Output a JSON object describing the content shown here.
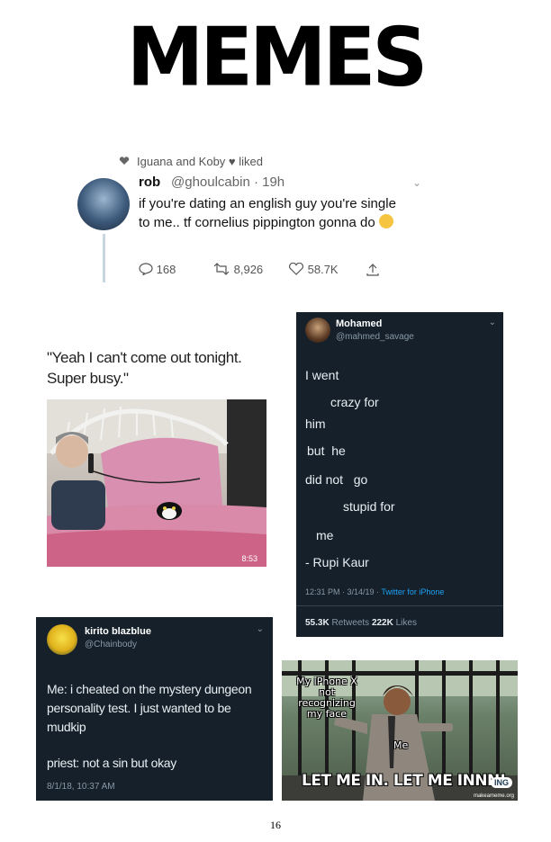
{
  "title": "MEMES",
  "tweet1": {
    "liked_by": "Iguana and Koby ♥ liked",
    "name": "rob",
    "handle_time": "@ghoulcabin · 19h",
    "text": "if you're dating an english guy you're single to me.. tf cornelius pippington gonna do",
    "replies": "168",
    "retweets": "8,926",
    "likes": "58.7K"
  },
  "quote_post": {
    "quote": "\"Yeah I can't come out tonight. Super busy.\"",
    "watermark": "8:53"
  },
  "tweet_rupi": {
    "name": "Mohamed",
    "handle": "@mahmed_savage",
    "lines": [
      "I went",
      "crazy for",
      "him",
      "but  he",
      "did not   go",
      "stupid for",
      "me",
      "- Rupi Kaur"
    ],
    "meta": "12:31 PM · 3/14/19 ·",
    "client": "Twitter for iPhone",
    "retweets_count": "55.3K",
    "retweets_label": "Retweets",
    "likes_count": "222K",
    "likes_label": "Likes"
  },
  "tweet_kirito": {
    "name": "kirito blazblue",
    "handle": "@Chainbody",
    "text1": "Me: i cheated on the mystery dungeon personality test. I just wanted to be mudkip",
    "text2": "priest: not a sin but okay",
    "date": "8/1/18, 10:37 AM"
  },
  "meme": {
    "label_phone": "My iPhone X not recognizing my face",
    "label_me": "Me",
    "caption": "LET ME IN. LET ME INNN!",
    "badge": "ING",
    "watermark": "makeameme.org"
  },
  "page_number": "16"
}
